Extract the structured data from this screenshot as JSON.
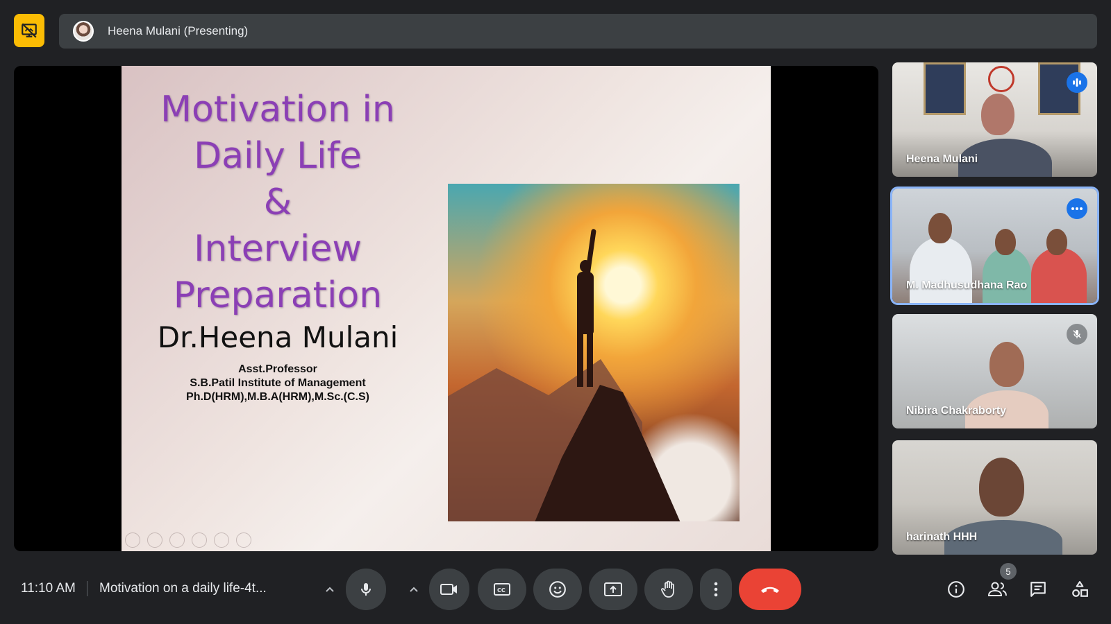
{
  "top": {
    "presenter_label": "Heena Mulani (Presenting)"
  },
  "slide": {
    "title_lines": [
      "Motivation in",
      "Daily Life",
      "&",
      "Interview",
      "Preparation"
    ],
    "author": "Dr.Heena Mulani",
    "subtitle_lines": [
      "Asst.Professor",
      "S.B.Patil Institute of Management",
      "Ph.D(HRM),M.B.A(HRM),M.Sc.(C.S)"
    ]
  },
  "participants": [
    {
      "name": "Heena Mulani",
      "badge": "audio-level-icon"
    },
    {
      "name": "M. Madhusudhana Rao",
      "badge": "more-options-icon"
    },
    {
      "name": "Nibira Chakraborty",
      "badge": "mic-off-icon"
    },
    {
      "name": "harinath HHH",
      "badge": ""
    }
  ],
  "bottom": {
    "time": "11:10 AM",
    "meeting_title": "Motivation on a daily life-4t...",
    "people_count": "5"
  },
  "colors": {
    "background": "#202124",
    "control": "#3c4043",
    "end_call": "#ea4335",
    "active_border": "#8ab4f8",
    "presenting_badge": "#fbbc04",
    "slide_title": "#8b3fb5"
  }
}
